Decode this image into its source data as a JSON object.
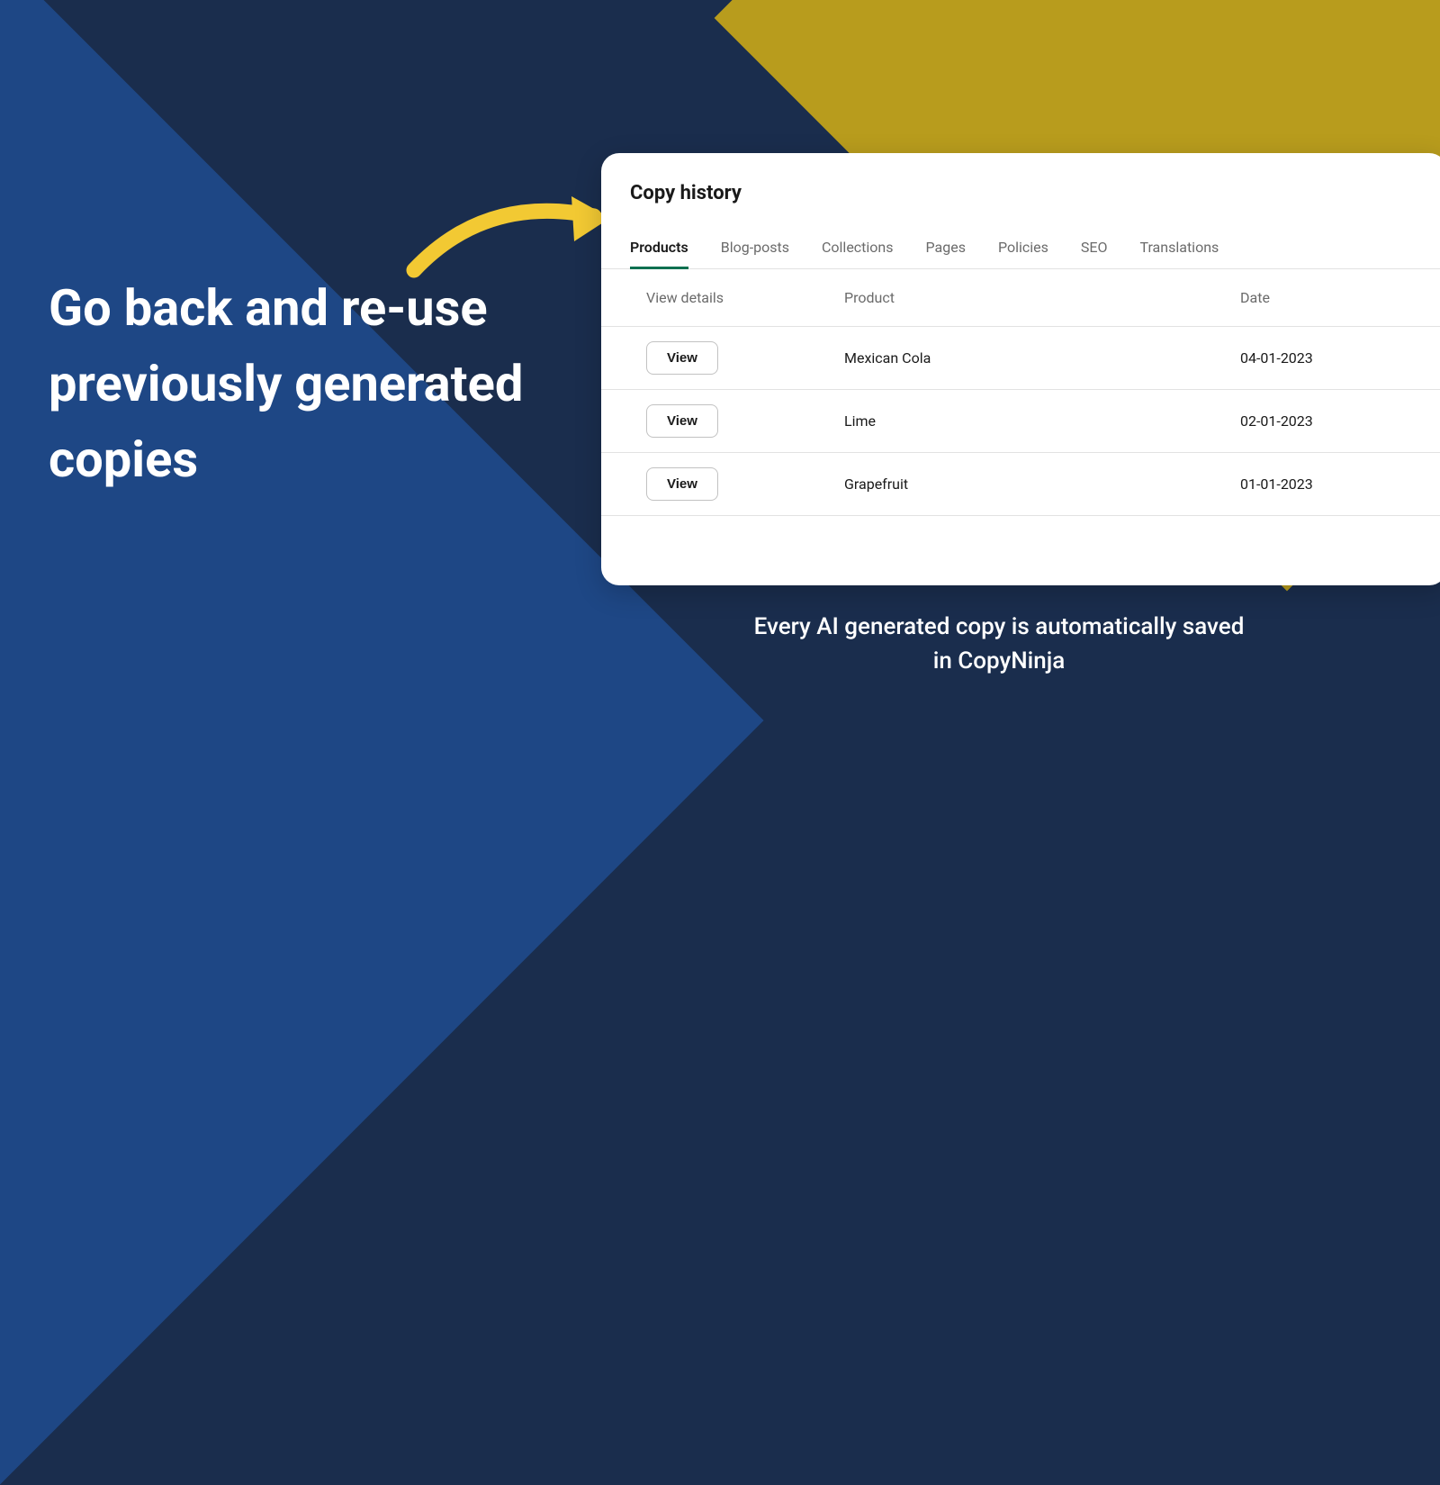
{
  "headline": "Go back and re-use previously generated copies",
  "subtext": "Every AI generated copy is automatically saved in CopyNinja",
  "card": {
    "title": "Copy history",
    "tabs": [
      {
        "label": "Products",
        "active": true
      },
      {
        "label": "Blog-posts",
        "active": false
      },
      {
        "label": "Collections",
        "active": false
      },
      {
        "label": "Pages",
        "active": false
      },
      {
        "label": "Policies",
        "active": false
      },
      {
        "label": "SEO",
        "active": false
      },
      {
        "label": "Translations",
        "active": false
      }
    ],
    "columns": {
      "view_details": "View details",
      "product": "Product",
      "date": "Date"
    },
    "rows": [
      {
        "button_label": "View",
        "product": "Mexican Cola",
        "date": "04-01-2023"
      },
      {
        "button_label": "View",
        "product": "Lime",
        "date": "02-01-2023"
      },
      {
        "button_label": "View",
        "product": "Grapefruit",
        "date": "01-01-2023"
      }
    ]
  },
  "colors": {
    "accent_yellow": "#f2c933",
    "bg_dark": "#1a2d4d",
    "bg_blue": "#1e4785",
    "bg_olive": "#b89c1d",
    "tab_active": "#0d7050"
  }
}
